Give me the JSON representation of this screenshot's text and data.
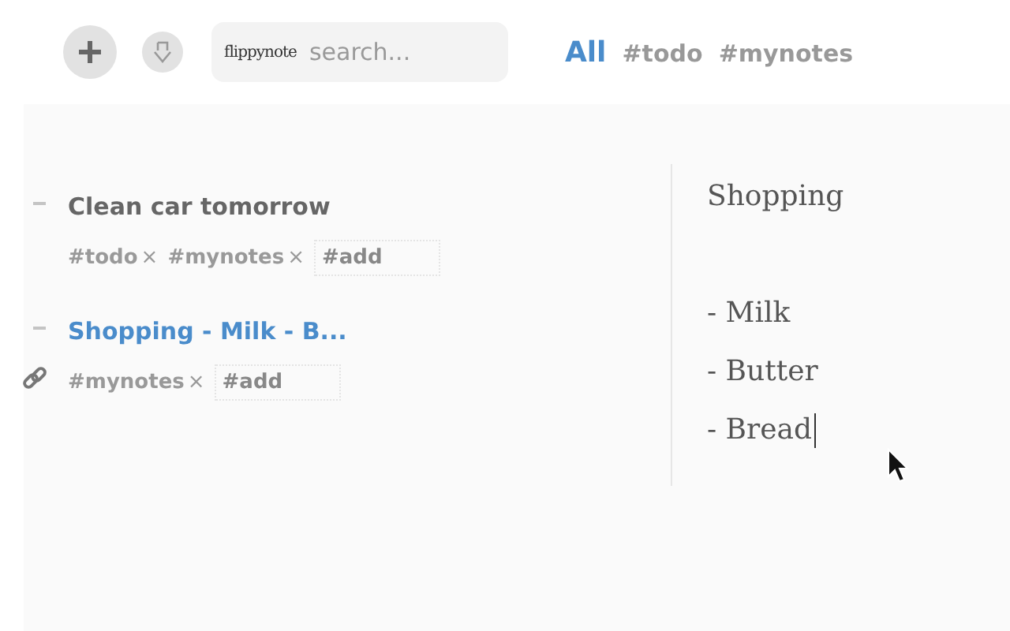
{
  "toolbar": {
    "logo": "flippynote",
    "search": {
      "placeholder": "search..."
    }
  },
  "filters": [
    {
      "label": "All",
      "selected": true
    },
    {
      "label": "#todo",
      "selected": false
    },
    {
      "label": "#mynotes",
      "selected": false
    }
  ],
  "notes": [
    {
      "title": "Clean car tomorrow",
      "selected": false,
      "linked": false,
      "tags": [
        {
          "label": "#todo",
          "remove": "×"
        },
        {
          "label": "#mynotes",
          "remove": "×"
        }
      ],
      "add_placeholder": "#add"
    },
    {
      "title": "Shopping - Milk - B...",
      "selected": true,
      "linked": true,
      "tags": [
        {
          "label": "#mynotes",
          "remove": "×"
        }
      ],
      "add_placeholder": "#add"
    }
  ],
  "editor": {
    "title": "Shopping",
    "items": [
      "- Milk",
      "- Butter",
      "- Bread"
    ]
  }
}
